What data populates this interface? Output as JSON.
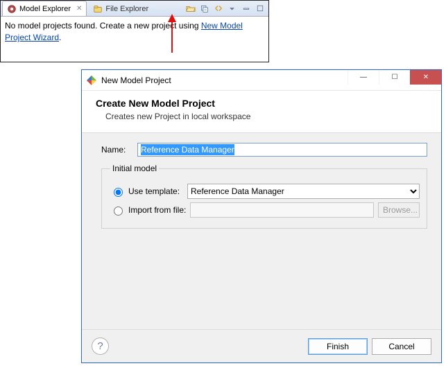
{
  "view": {
    "tabs": [
      {
        "label": "Model Explorer",
        "active": true
      },
      {
        "label": "File Explorer",
        "active": false
      }
    ],
    "message_prefix": "No model projects found. Create a new project using ",
    "link_text": "New Model Project Wizard",
    "message_suffix": "."
  },
  "toolbar_icons": {
    "open_folder": "open-folder-icon",
    "collapse_all": "collapse-all-icon",
    "link_editor": "link-with-editor-icon",
    "view_menu": "view-menu-icon",
    "minimize": "minimize-view-icon",
    "maximize": "maximize-view-icon"
  },
  "dialog": {
    "title": "New Model Project",
    "heading": "Create New Model Project",
    "subheading": "Creates new Project in local workspace",
    "name_label": "Name:",
    "name_value": "Reference Data Manager",
    "group_label": "Initial model",
    "use_template_label": "Use template:",
    "template_options": [
      "Reference Data Manager"
    ],
    "template_selected": "Reference Data Manager",
    "import_label": "Import from file:",
    "import_value": "",
    "browse_label": "Browse...",
    "buttons": {
      "finish": "Finish",
      "cancel": "Cancel"
    }
  },
  "win_controls": {
    "minimize": "—",
    "maximize": "☐",
    "close": "✕"
  }
}
